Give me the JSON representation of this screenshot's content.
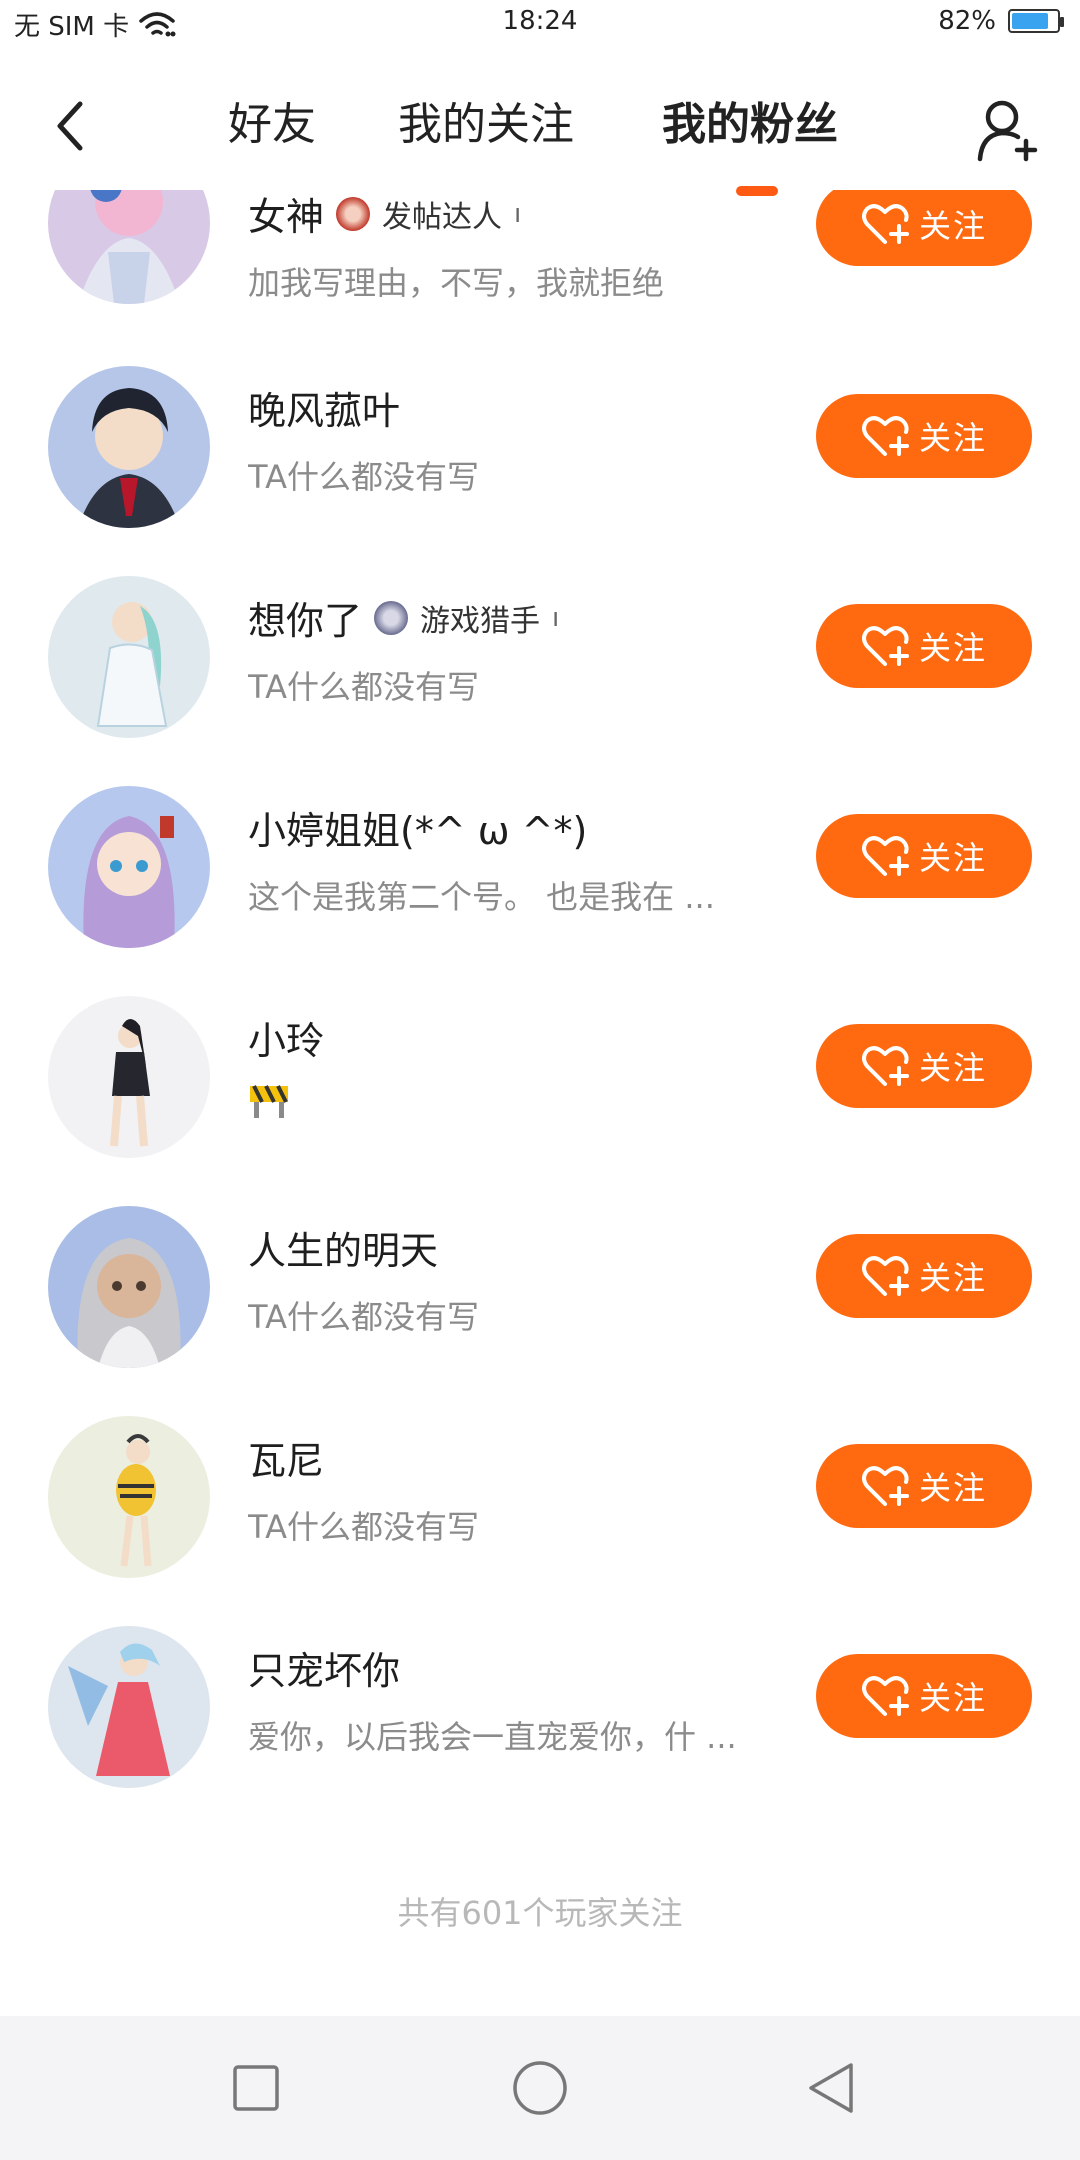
{
  "status_bar": {
    "carrier": "无 SIM 卡",
    "time": "18:24",
    "battery_percent": "82%",
    "battery_level": 0.82
  },
  "header": {
    "tabs": [
      {
        "label": "好友",
        "active": false
      },
      {
        "label": "我的关注",
        "active": false
      },
      {
        "label": "我的粉丝",
        "active": true
      }
    ]
  },
  "follow_label": "关注",
  "fans": [
    {
      "name": "女神",
      "badge": "发帖达人",
      "desc": "加我写理由，不写，我就拒绝"
    },
    {
      "name": "晚风菰叶",
      "desc": "TA什么都没有写"
    },
    {
      "name": "想你了",
      "badge": "游戏猎手",
      "desc": "TA什么都没有写"
    },
    {
      "name": "小婷姐姐(*^ ω ^*)",
      "desc": "这个是我第二个号。 也是我在 ..."
    },
    {
      "name": "小玲",
      "desc": ""
    },
    {
      "name": "人生的明天",
      "desc": "TA什么都没有写"
    },
    {
      "name": "瓦尼",
      "desc": "TA什么都没有写"
    },
    {
      "name": "只宠坏你",
      "desc": "爱你，以后我会一直宠爱你，什 ..."
    }
  ],
  "footer": {
    "total_text": "共有601个玩家关注"
  },
  "colors": {
    "accent": "#ff6a10",
    "indicator": "#ff5a14"
  }
}
